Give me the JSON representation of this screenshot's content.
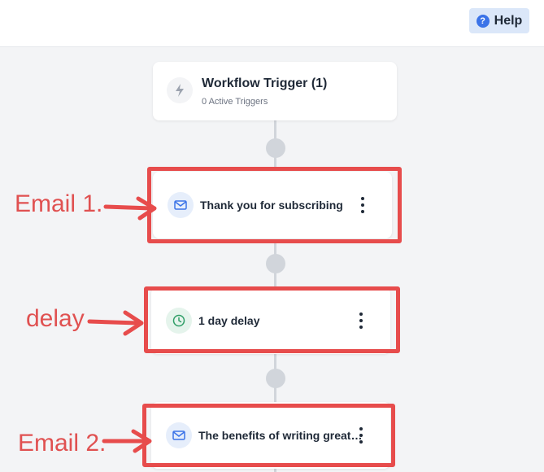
{
  "header": {
    "help_label": "Help",
    "help_icon": "question-circle-icon"
  },
  "trigger": {
    "title": "Workflow Trigger (1)",
    "subtitle": "0 Active Triggers",
    "icon": "lightning-icon"
  },
  "steps": [
    {
      "label": "Thank you for subscribing",
      "icon": "mail-icon"
    },
    {
      "label": "1 day delay",
      "icon": "clock-icon"
    },
    {
      "label": "The benefits of writing great content",
      "icon": "mail-icon"
    }
  ],
  "annotations": {
    "email1": "Email 1.",
    "delay": "delay",
    "email2": "Email 2."
  },
  "colors": {
    "highlight": "#e74c4c",
    "annotation_text": "#e05151",
    "help_accent": "#3b73e8"
  }
}
